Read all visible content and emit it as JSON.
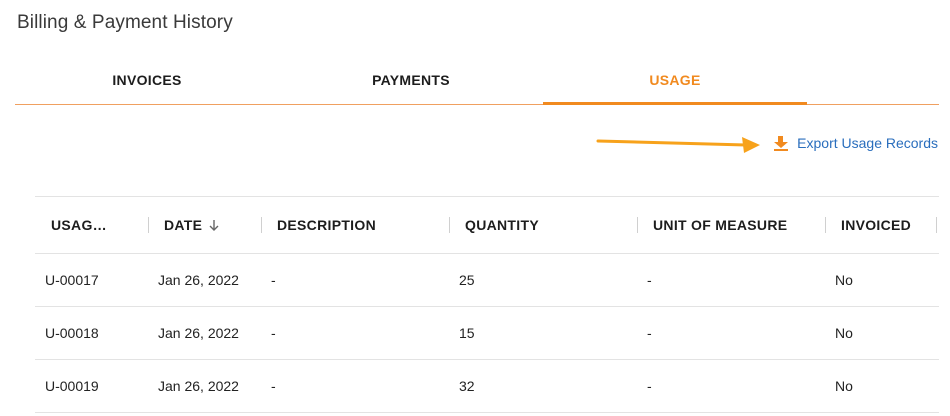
{
  "page": {
    "title": "Billing & Payment History"
  },
  "tabs": [
    {
      "label": "INVOICES",
      "active": false
    },
    {
      "label": "PAYMENTS",
      "active": false
    },
    {
      "label": "USAGE",
      "active": true
    }
  ],
  "export": {
    "label": "Export Usage Records",
    "icon": "download-icon"
  },
  "table": {
    "columns": [
      {
        "label": "USAG…"
      },
      {
        "label": "DATE",
        "sort": "descending"
      },
      {
        "label": "DESCRIPTION"
      },
      {
        "label": "QUANTITY"
      },
      {
        "label": "UNIT OF MEASURE"
      },
      {
        "label": "INVOICED"
      }
    ],
    "rows": [
      {
        "usage": "U-00017",
        "date": "Jan 26, 2022",
        "description": "-",
        "quantity": "25",
        "unit": "-",
        "invoiced": "No"
      },
      {
        "usage": "U-00018",
        "date": "Jan 26, 2022",
        "description": "-",
        "quantity": "15",
        "unit": "-",
        "invoiced": "No"
      },
      {
        "usage": "U-00019",
        "date": "Jan 26, 2022",
        "description": "-",
        "quantity": "32",
        "unit": "-",
        "invoiced": "No"
      }
    ]
  },
  "colors": {
    "accent": "#f18a1f",
    "link": "#2a6ebd",
    "annotation_arrow": "#f7a21b"
  }
}
